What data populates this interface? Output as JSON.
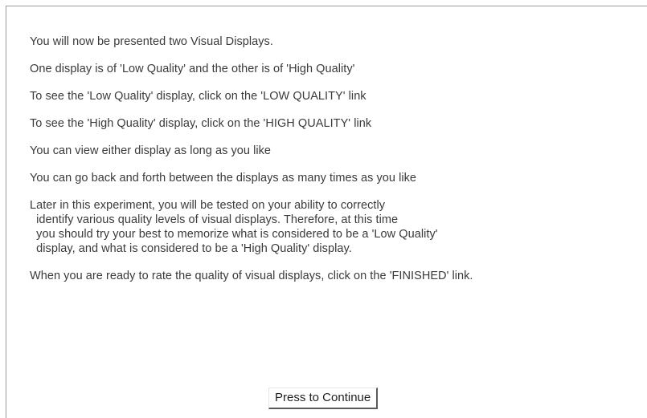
{
  "instructions": {
    "p1": "You will now be presented two Visual Displays.",
    "p2": "One display is of 'Low Quality' and the other is of 'High Quality'",
    "p3": "To see the 'Low Quality' display, click on the 'LOW QUALITY' link",
    "p4": "To see the 'High Quality' display, click on the 'HIGH QUALITY' link",
    "p5": "You can view either display as long as you like",
    "p6": "You can go back and forth between the displays as many times as you like",
    "p7": "Later in this experiment, you will be tested on your ability to correctly\n  identify various quality levels of visual displays. Therefore, at this time\n  you should try your best to memorize what is considered to be a 'Low Quality'\n  display, and what is considered to be a 'High Quality' display.",
    "p8": "When you are ready to rate the quality of visual displays, click on the 'FINISHED' link."
  },
  "continue_button": {
    "label": "Press to Continue"
  }
}
